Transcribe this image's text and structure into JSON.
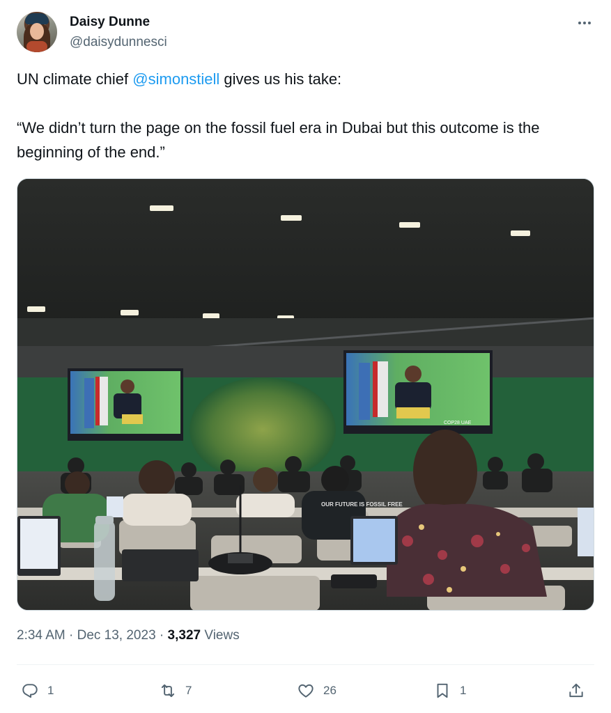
{
  "author": {
    "display_name": "Daisy Dunne",
    "handle": "@daisydunnesci",
    "avatar_icon": "profile-photo"
  },
  "tweet": {
    "line1_before": "UN climate chief ",
    "mention": "@simonstiell",
    "line1_after": " gives us his take:",
    "quote": "“We didn’t turn the page on the fossil fuel era in Dubai but this outcome is the beginning of the end.”"
  },
  "media": {
    "description_icon": "conference-hall-photo",
    "screen_text": "COP28 UAE",
    "shirt_text": "OUR FUTURE IS FOSSIL FREE"
  },
  "meta": {
    "time": "2:34 AM",
    "separator": "·",
    "date": "Dec 13, 2023",
    "views_count": "3,327",
    "views_label": "Views"
  },
  "actions": {
    "reply_count": "1",
    "repost_count": "7",
    "like_count": "26",
    "bookmark_count": "1"
  },
  "colors": {
    "accent": "#1d9bf0",
    "secondary_text": "#536471",
    "primary_text": "#0f1419"
  }
}
